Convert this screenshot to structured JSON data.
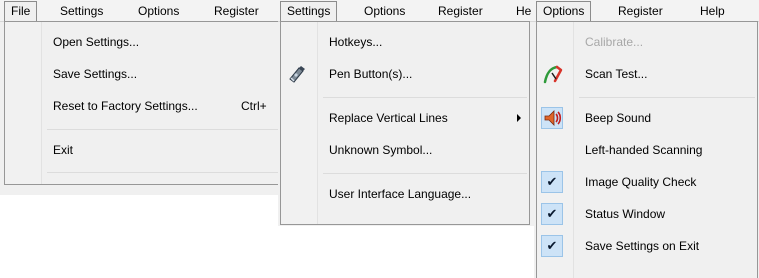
{
  "left_window": {
    "menubar": [
      "File",
      "Settings",
      "Options",
      "Register"
    ],
    "file_menu": {
      "open": "Open Settings...",
      "save": "Save Settings...",
      "reset": "Reset to Factory Settings...",
      "reset_shortcut": "Ctrl+",
      "exit": "Exit"
    }
  },
  "middle_window": {
    "menubar": [
      "Settings",
      "Options",
      "Register",
      "He"
    ],
    "settings_menu": {
      "hotkeys": "Hotkeys...",
      "pen_button": "Pen Button(s)...",
      "replace_lines": "Replace Vertical Lines",
      "unknown_symbol": "Unknown Symbol...",
      "ui_language": "User Interface Language..."
    }
  },
  "right_window": {
    "menubar": [
      "Options",
      "Register",
      "Help"
    ],
    "options_menu": {
      "calibrate": "Calibrate...",
      "scan_test": "Scan Test...",
      "beep_sound": "Beep Sound",
      "left_handed": "Left-handed Scanning",
      "image_quality": "Image Quality Check",
      "status_window": "Status Window",
      "save_on_exit": "Save Settings on Exit"
    },
    "checked": {
      "image_quality": true,
      "status_window": true,
      "save_on_exit": true
    },
    "check_glyph": "✔"
  },
  "icons": {
    "pen_button": "pen-icon",
    "scan_test": "scan-test-icon",
    "beep_sound": "speaker-icon"
  }
}
